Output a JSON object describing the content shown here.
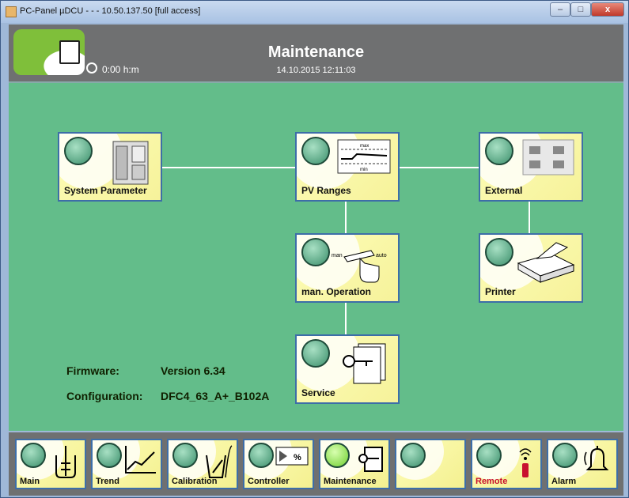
{
  "window": {
    "title": "PC-Panel µDCU - - - 10.50.137.50 [full access]",
    "min_glyph": "–",
    "max_glyph": "□",
    "close_glyph": "x"
  },
  "header": {
    "title": "Maintenance",
    "timer": "0:00 h:m",
    "datetime": "14.10.2015   12:11:03"
  },
  "tiles": {
    "system_parameter": "System Parameter",
    "pv_ranges": "PV Ranges",
    "external": "External",
    "man_operation": "man. Operation",
    "printer": "Printer",
    "service": "Service"
  },
  "pv_icon": {
    "max": "max",
    "min": "min"
  },
  "manop_icon": {
    "man": "man",
    "auto": "auto"
  },
  "firmware": {
    "firmware_label": "Firmware:",
    "firmware_value": "Version 6.34",
    "config_label": "Configuration:",
    "config_value": "DFC4_63_A+_B102A"
  },
  "nav": {
    "main": "Main",
    "trend": "Trend",
    "calibration": "Calibration",
    "controller": "Controller",
    "maintenance": "Maintenance",
    "blank": "",
    "remote": "Remote",
    "alarm": "Alarm"
  },
  "controller_icon_text": "%",
  "colors": {
    "panel_green": "#63bd8a",
    "header_gray": "#6f7071",
    "tile_yellow": "#f6f29a",
    "remote_red": "#c8102e",
    "active_led": "#6fcf2f"
  }
}
